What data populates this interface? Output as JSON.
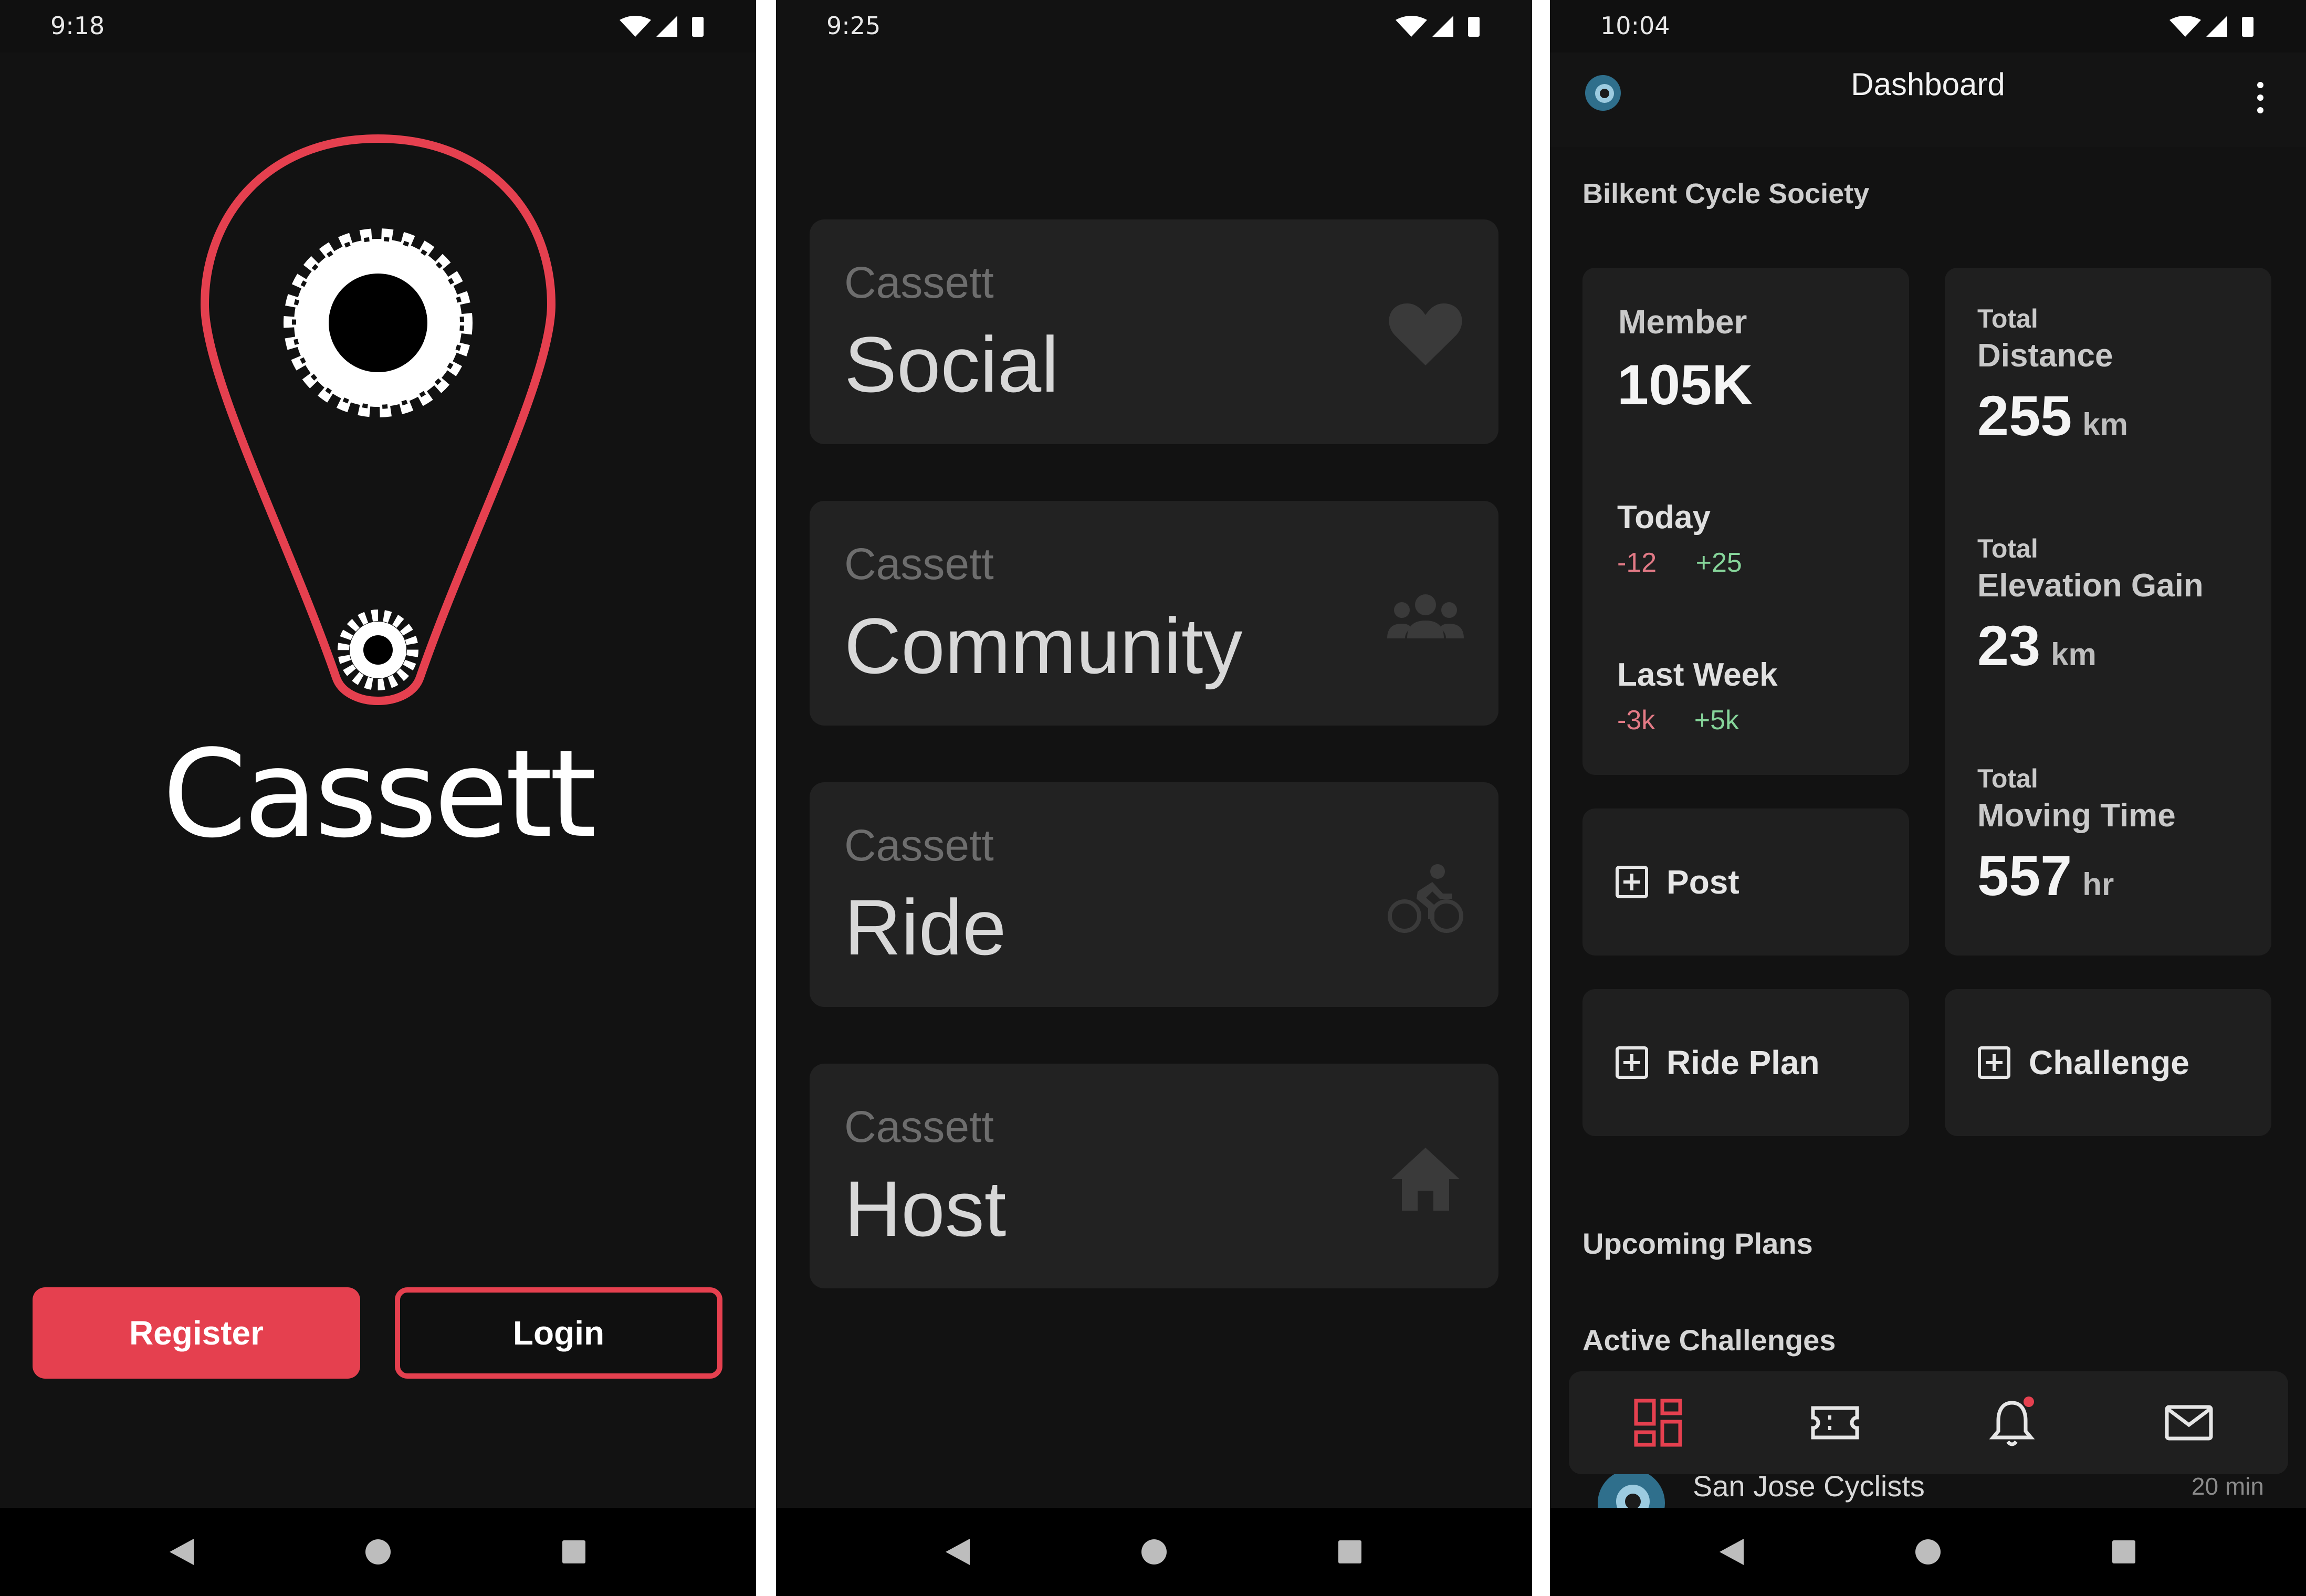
{
  "screens": {
    "login": {
      "status_time": "9:18",
      "brand_name": "Cassett",
      "register_label": "Register",
      "login_label": "Login"
    },
    "mode_select": {
      "status_time": "9:25",
      "cards": [
        {
          "prefix": "Cassett",
          "name": "Social",
          "icon": "heart-icon"
        },
        {
          "prefix": "Cassett",
          "name": "Community",
          "icon": "group-icon"
        },
        {
          "prefix": "Cassett",
          "name": "Ride",
          "icon": "cyclist-icon"
        },
        {
          "prefix": "Cassett",
          "name": "Host",
          "icon": "home-icon"
        }
      ]
    },
    "dashboard": {
      "status_time": "10:04",
      "title": "Dashboard",
      "group_name": "Bilkent Cycle Society",
      "member": {
        "label": "Member",
        "value": "105K",
        "today_label": "Today",
        "today_neg": "-12",
        "today_pos": "+25",
        "week_label": "Last Week",
        "week_neg": "-3k",
        "week_pos": "+5k"
      },
      "stats": [
        {
          "prefix": "Total",
          "label": "Distance",
          "value": "255",
          "unit": "km"
        },
        {
          "prefix": "Total",
          "label": "Elevation Gain",
          "value": "23",
          "unit": "km"
        },
        {
          "prefix": "Total",
          "label": "Moving Time",
          "value": "557",
          "unit": "hr"
        }
      ],
      "actions": {
        "post": "Post",
        "ride_plan": "Ride Plan",
        "challenge": "Challenge"
      },
      "sections": {
        "upcoming": "Upcoming Plans",
        "challenges": "Active Challenges"
      },
      "peek_item": {
        "name": "San Jose Cyclists",
        "time": "20 min"
      },
      "colors": {
        "accent": "#e5404f",
        "positive": "#86d59a",
        "negative": "#e37a86"
      }
    }
  }
}
